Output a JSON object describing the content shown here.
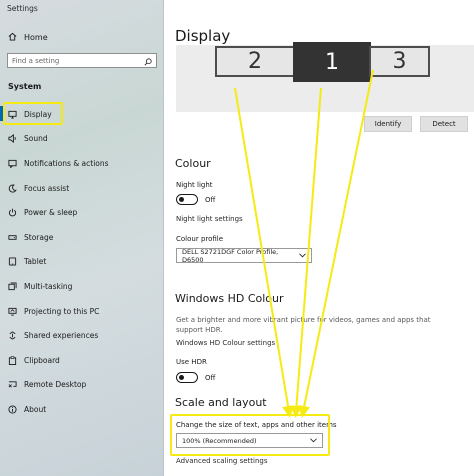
{
  "window": {
    "title": "Settings"
  },
  "sidebar": {
    "home_label": "Home",
    "search_placeholder": "Find a setting",
    "section_label": "System",
    "items": [
      {
        "label": "Display",
        "icon": "monitor-icon"
      },
      {
        "label": "Sound",
        "icon": "speaker-icon"
      },
      {
        "label": "Notifications & actions",
        "icon": "notification-icon"
      },
      {
        "label": "Focus assist",
        "icon": "moon-icon"
      },
      {
        "label": "Power & sleep",
        "icon": "power-icon"
      },
      {
        "label": "Storage",
        "icon": "storage-icon"
      },
      {
        "label": "Tablet",
        "icon": "tablet-icon"
      },
      {
        "label": "Multi-tasking",
        "icon": "multitask-icon"
      },
      {
        "label": "Projecting to this PC",
        "icon": "project-icon"
      },
      {
        "label": "Shared experiences",
        "icon": "shared-icon"
      },
      {
        "label": "Clipboard",
        "icon": "clipboard-icon"
      },
      {
        "label": "Remote Desktop",
        "icon": "remote-icon"
      },
      {
        "label": "About",
        "icon": "info-icon"
      }
    ]
  },
  "main": {
    "title": "Display",
    "monitors": [
      "2",
      "1",
      "3"
    ],
    "identify_label": "Identify",
    "detect_label": "Detect",
    "colour": {
      "heading": "Colour",
      "night_light_label": "Night light",
      "night_light_state": "Off",
      "night_light_settings": "Night light settings",
      "profile_label": "Colour profile",
      "profile_value": "DELL S2721DGF Color Profile, D6500"
    },
    "hd": {
      "heading": "Windows HD Colour",
      "description_line1": "Get a brighter and more vibrant picture for videos, games and apps that",
      "description_line2": "support HDR.",
      "settings_link": "Windows HD Colour settings",
      "use_hdr_label": "Use HDR",
      "use_hdr_state": "Off"
    },
    "scale": {
      "heading": "Scale and layout",
      "size_label": "Change the size of text, apps and other items",
      "size_value": "100% (Recommended)",
      "advanced_link": "Advanced scaling settings"
    }
  },
  "colors": {
    "highlight": "#f6ea13",
    "accent": "#0067c0",
    "primary_monitor": "#333333"
  }
}
